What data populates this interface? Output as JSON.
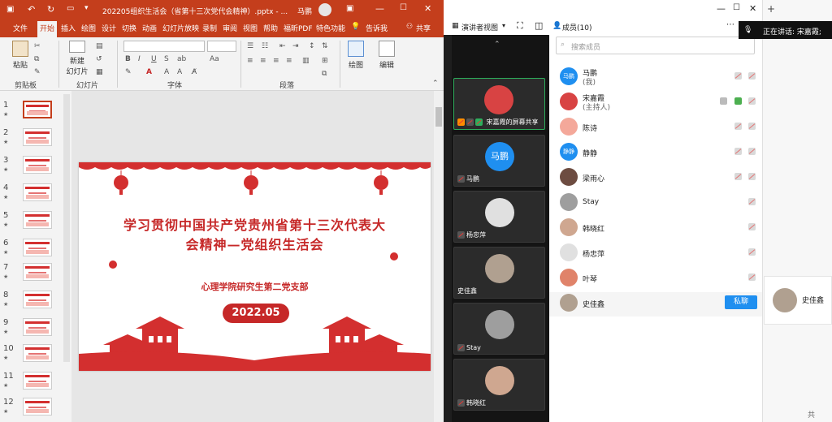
{
  "ppt": {
    "window_title": "202205组织生活会（省第十三次党代会精神）.pptx - ...",
    "user_name": "马鹏",
    "tabs": [
      "文件",
      "开始",
      "插入",
      "绘图",
      "设计",
      "切换",
      "动画",
      "幻灯片放映",
      "录制",
      "审阅",
      "视图",
      "帮助",
      "福昕PDF",
      "特色功能"
    ],
    "active_tab": "开始",
    "tell_me": "告诉我",
    "share": "共享",
    "ribbon": {
      "paste": "粘贴",
      "clipboard": "剪贴板",
      "new_slide_1": "新建",
      "new_slide_2": "幻灯片",
      "slides_group": "幻灯片",
      "font_group": "字体",
      "paragraph_group": "段落",
      "drawing": "绘图",
      "editing": "编辑"
    },
    "thumbnails": [
      "1",
      "2",
      "3",
      "4",
      "5",
      "6",
      "7",
      "8",
      "9",
      "10",
      "11",
      "12"
    ],
    "slide": {
      "title_line1": "学习贯彻中国共产党贵州省第十三次代表大",
      "title_line2": "会精神—党组织生活会",
      "subtitle": "心理学院研究生第二党支部",
      "date": "2022.05"
    }
  },
  "meeting": {
    "presenter_view": "演讲者视图",
    "tiles": [
      {
        "label": "宋嘉霞的屏幕共享"
      },
      {
        "label": "马鹏",
        "avatar_text": "马鹏"
      },
      {
        "label": "杨忠萍"
      },
      {
        "label": "史佳鑫"
      },
      {
        "label": "Stay"
      },
      {
        "label": "韩晓红"
      }
    ],
    "members_title": "成员(10)",
    "search_placeholder": "搜索成员",
    "members": [
      {
        "name": "马鹏",
        "role": "(我)",
        "avatar_text": "马鹏",
        "color": "#1f8ff0"
      },
      {
        "name": "宋嘉霞",
        "role": "(主持人)",
        "color": "#d84343"
      },
      {
        "name": "陈诗",
        "role": "",
        "color": "#f4a89a"
      },
      {
        "name": "静静",
        "role": "",
        "avatar_text": "静静",
        "color": "#1f8ff0"
      },
      {
        "name": "梁雨心",
        "role": "",
        "color": "#6d4c41"
      },
      {
        "name": "Stay",
        "role": "",
        "color": "#9e9e9e"
      },
      {
        "name": "韩晓红",
        "role": "",
        "color": "#cfa790"
      },
      {
        "name": "杨忠萍",
        "role": "",
        "color": "#e0e0e0"
      },
      {
        "name": "叶琴",
        "role": "",
        "color": "#e0836a"
      },
      {
        "name": "史佳鑫",
        "role": "",
        "color": "#b0a090"
      }
    ],
    "private_chat": "私聊",
    "speaking": "正在讲话: 宋嘉霞;",
    "right_tile_name": "史佳鑫"
  }
}
